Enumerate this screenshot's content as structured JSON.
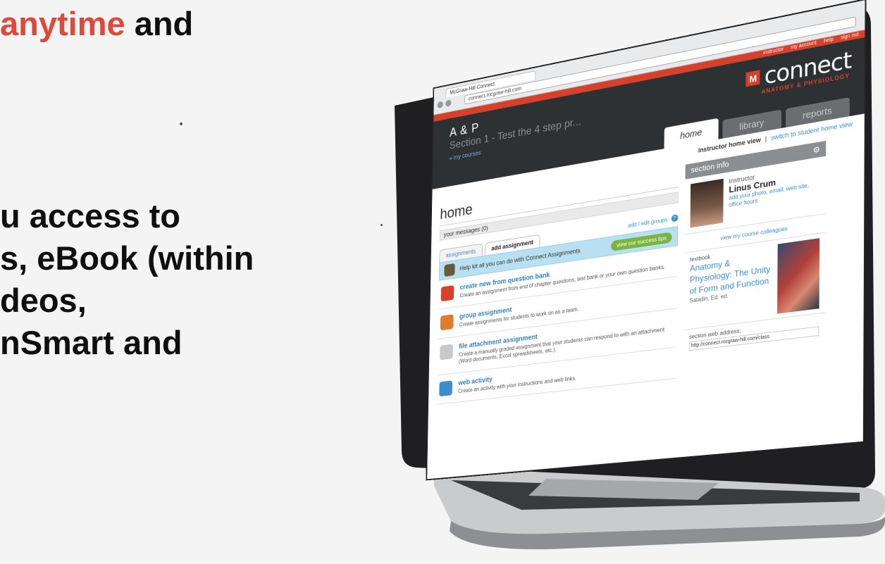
{
  "slide": {
    "lines": [
      {
        "red": "anytime",
        "rest": " and"
      },
      {
        "red": "",
        "rest": "u access to"
      },
      {
        "red": "",
        "rest": "s, eBook (within"
      },
      {
        "red": "",
        "rest": "deos,"
      },
      {
        "red": "",
        "rest": "nSmart and"
      }
    ],
    "accent_color": "#e0483a"
  },
  "browser": {
    "tab_title": "McGraw-Hill Connect",
    "url": "connect.mcgraw-hill.com"
  },
  "app": {
    "top_links": [
      "instructor",
      "my account",
      "help",
      "sign out"
    ],
    "course_code": "A & P",
    "course_section": "Section 1 - Test the 4 step pr...",
    "course_link": "» my courses",
    "logo_mark": "M",
    "logo_text": "connect",
    "logo_tag": "ANATOMY & PHYSIOLOGY",
    "tabs": [
      "home",
      "library",
      "reports"
    ],
    "active_tab": "home",
    "view_label": "instructor home view",
    "view_switch": "switch to student home view",
    "brand_color": "#d7412c"
  },
  "home": {
    "title": "home",
    "messages": "your messages (0)",
    "subtabs": [
      "assignments",
      "add assignment"
    ],
    "groups_link": "add / edit groups",
    "promo_text": "Help kit all you can do with Connect Assignments",
    "promo_button": "view our success tips",
    "items": [
      {
        "title": "create new from question bank",
        "desc": "Create an assignment from end of chapter questions, test bank or your own question banks."
      },
      {
        "title": "group assignment",
        "desc": "Create assignments for students to work on as a team."
      },
      {
        "title": "file attachment assignment",
        "desc": "Create a manually graded assignment that your students can respond to with an attachment (Word documents, Excel spreadsheets, etc.)."
      },
      {
        "title": "web activity",
        "desc": "Create an activity with your instructions and web links."
      }
    ]
  },
  "section_info": {
    "title": "section info",
    "instructor_label": "instructor",
    "instructor_name": "Linus Crum",
    "instructor_links": "add your photo, email, web site, office hours",
    "colleagues_link": "view my course colleagues",
    "textbook_label": "textbook",
    "textbook_title": "Anatomy & Physiology: The Unity of Form and Function",
    "textbook_author": "Saladin, Ed. ed.",
    "web_label": "section web address:",
    "web_url": "http://connect.mcgraw-hill.com/class"
  }
}
